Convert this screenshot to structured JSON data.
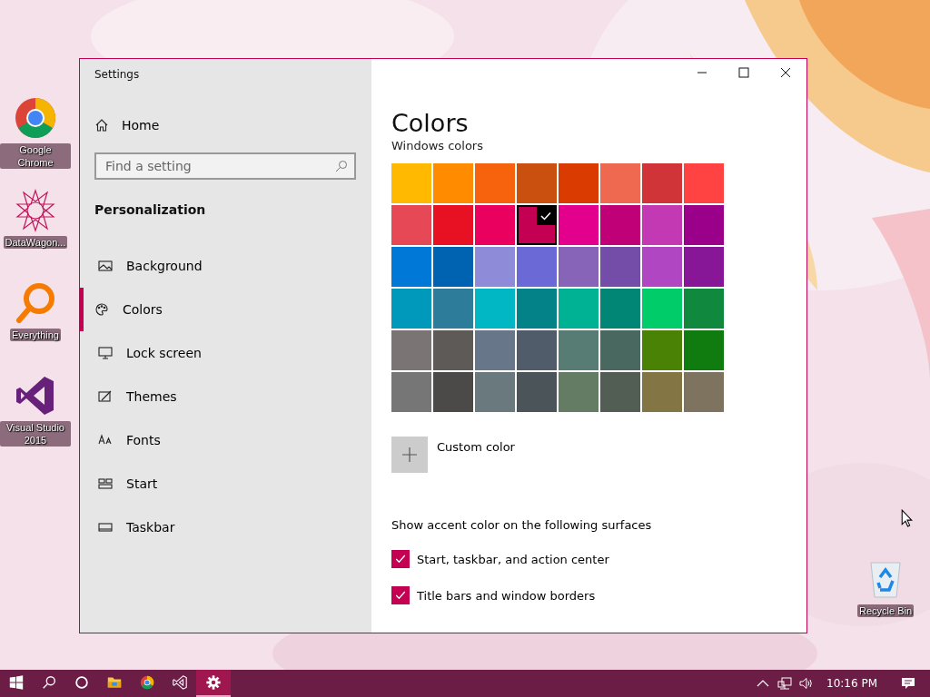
{
  "desktop_icons": [
    {
      "label": "Google Chrome"
    },
    {
      "label": "DataWagon..."
    },
    {
      "label": "Everything"
    },
    {
      "label": "Visual Studio 2015"
    },
    {
      "label": "Recycle Bin"
    }
  ],
  "window": {
    "title": "Settings"
  },
  "sidebar": {
    "home": "Home",
    "search": {
      "placeholder": "Find a setting"
    },
    "section": "Personalization",
    "items": [
      {
        "label": "Background",
        "selected": false
      },
      {
        "label": "Colors",
        "selected": true
      },
      {
        "label": "Lock screen",
        "selected": false
      },
      {
        "label": "Themes",
        "selected": false
      },
      {
        "label": "Fonts",
        "selected": false
      },
      {
        "label": "Start",
        "selected": false
      },
      {
        "label": "Taskbar",
        "selected": false
      }
    ]
  },
  "page": {
    "title": "Colors",
    "subtitle": "Windows colors",
    "swatches": [
      {
        "color": "#ffb900",
        "selected": false
      },
      {
        "color": "#ff8c00",
        "selected": false
      },
      {
        "color": "#f7630c",
        "selected": false
      },
      {
        "color": "#ca5010",
        "selected": false
      },
      {
        "color": "#da3b01",
        "selected": false
      },
      {
        "color": "#ef6950",
        "selected": false
      },
      {
        "color": "#d13438",
        "selected": false
      },
      {
        "color": "#ff4343",
        "selected": false
      },
      {
        "color": "#e74856",
        "selected": false
      },
      {
        "color": "#e81123",
        "selected": false
      },
      {
        "color": "#ea005e",
        "selected": false
      },
      {
        "color": "#c30052",
        "selected": true
      },
      {
        "color": "#e3008c",
        "selected": false
      },
      {
        "color": "#bf0077",
        "selected": false
      },
      {
        "color": "#c239b3",
        "selected": false
      },
      {
        "color": "#9a0089",
        "selected": false
      },
      {
        "color": "#0078d7",
        "selected": false
      },
      {
        "color": "#0063b1",
        "selected": false
      },
      {
        "color": "#8e8cd8",
        "selected": false
      },
      {
        "color": "#6b69d6",
        "selected": false
      },
      {
        "color": "#8764b8",
        "selected": false
      },
      {
        "color": "#744da9",
        "selected": false
      },
      {
        "color": "#b146c2",
        "selected": false
      },
      {
        "color": "#881798",
        "selected": false
      },
      {
        "color": "#0099bc",
        "selected": false
      },
      {
        "color": "#2d7d9a",
        "selected": false
      },
      {
        "color": "#00b7c3",
        "selected": false
      },
      {
        "color": "#038387",
        "selected": false
      },
      {
        "color": "#00b294",
        "selected": false
      },
      {
        "color": "#018574",
        "selected": false
      },
      {
        "color": "#00cc6a",
        "selected": false
      },
      {
        "color": "#10893e",
        "selected": false
      },
      {
        "color": "#7a7574",
        "selected": false
      },
      {
        "color": "#5d5a58",
        "selected": false
      },
      {
        "color": "#68768a",
        "selected": false
      },
      {
        "color": "#515c6b",
        "selected": false
      },
      {
        "color": "#567c73",
        "selected": false
      },
      {
        "color": "#486860",
        "selected": false
      },
      {
        "color": "#498205",
        "selected": false
      },
      {
        "color": "#107c10",
        "selected": false
      },
      {
        "color": "#767676",
        "selected": false
      },
      {
        "color": "#4c4a48",
        "selected": false
      },
      {
        "color": "#69797e",
        "selected": false
      },
      {
        "color": "#4a5459",
        "selected": false
      },
      {
        "color": "#647c64",
        "selected": false
      },
      {
        "color": "#525e54",
        "selected": false
      },
      {
        "color": "#847545",
        "selected": false
      },
      {
        "color": "#7e735f",
        "selected": false
      }
    ],
    "custom_color": "Custom color",
    "surfaces_heading": "Show accent color on the following surfaces",
    "checkboxes": [
      {
        "label": "Start, taskbar, and action center",
        "checked": true
      },
      {
        "label": "Title bars and window borders",
        "checked": true
      }
    ]
  },
  "taskbar": {
    "apps": [
      {
        "selected": false
      },
      {
        "selected": false
      },
      {
        "selected": false
      },
      {
        "selected": false
      },
      {
        "selected": false
      },
      {
        "selected": false
      },
      {
        "selected": true
      }
    ],
    "time": "10:16 PM"
  }
}
